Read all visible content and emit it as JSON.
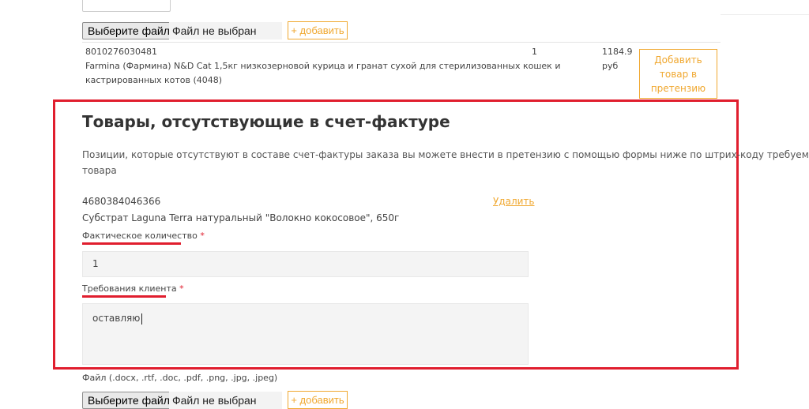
{
  "upload_top": {
    "choose_label": "Выберите файл",
    "status": "Файл не выбран",
    "add_label": "+ добавить"
  },
  "product_row": {
    "barcode": "8010276030481",
    "name_line1": "Farmina (Фармина) N&D Cat 1,5кг низкозерновой курица и гранат сухой для стерилизованных кошек и",
    "name_line2": "кастрированных котов (4048)",
    "qty": "1",
    "price": "1184.9",
    "currency": "руб",
    "add_claim_line1": "Добавить",
    "add_claim_line2": "товар в",
    "add_claim_line3": "претензию"
  },
  "missing": {
    "title": "Товары, отсутствующие в счет-фактуре",
    "desc_line1": "Позиции, которые отсутствуют в составе счет-фактуры заказа вы можете внести в претензию с помощью формы ниже по штрих-коду требуемого",
    "desc_line2": "товара",
    "barcode": "4680384046366",
    "delete_label": "Удалить",
    "product_name": "Субстрат Laguna Terra натуральный \"Волокно кокосовое\", 650г",
    "qty_label": "Фактическое количество",
    "qty_value": "1",
    "req_label": "Требования клиента",
    "req_value": "оставляю",
    "required_mark": "*"
  },
  "upload_bottom": {
    "file_types": "Файл (.docx, .rtf, .doc, .pdf, .png, .jpg, .jpeg)",
    "choose_label": "Выберите файл",
    "status": "Файл не выбран",
    "add_label": "+ добавить"
  },
  "colors": {
    "accent": "#f0a830",
    "highlight": "#e01e2e"
  }
}
